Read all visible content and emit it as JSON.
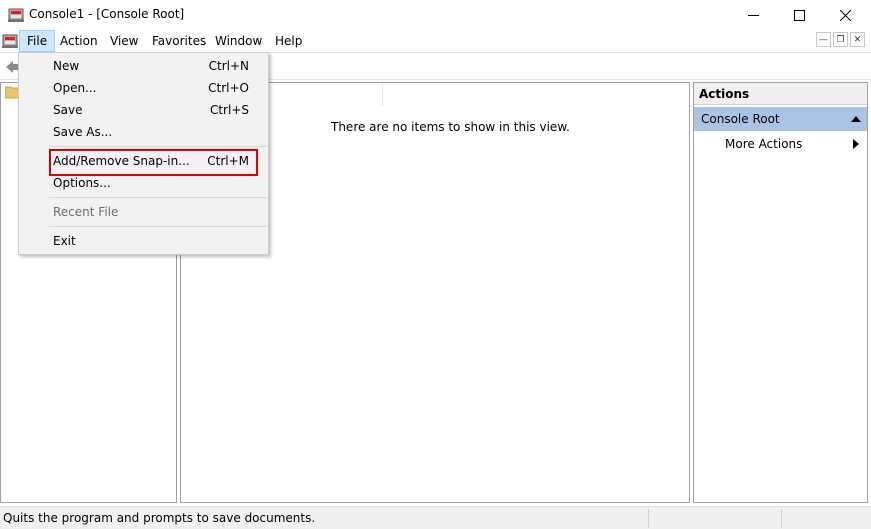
{
  "window": {
    "title": "Console1 - [Console Root]",
    "controls": [
      "minimize",
      "maximize",
      "close"
    ]
  },
  "menubar": {
    "items": [
      {
        "label": "File",
        "state": "open"
      },
      {
        "label": "Action"
      },
      {
        "label": "View"
      },
      {
        "label": "Favorites"
      },
      {
        "label": "Window"
      },
      {
        "label": "Help"
      }
    ]
  },
  "file_menu": {
    "items": [
      {
        "label": "New",
        "shortcut": "Ctrl+N"
      },
      {
        "label": "Open...",
        "shortcut": "Ctrl+O"
      },
      {
        "label": "Save",
        "shortcut": "Ctrl+S"
      },
      {
        "label": "Save As...",
        "shortcut": ""
      },
      {
        "label": "Add/Remove Snap-in...",
        "shortcut": "Ctrl+M",
        "highlighted": true
      },
      {
        "label": "Options...",
        "shortcut": ""
      },
      {
        "label": "Recent File",
        "shortcut": "",
        "disabled": true
      },
      {
        "label": "Exit",
        "shortcut": ""
      }
    ],
    "highlight_color": "#e00000"
  },
  "center_pane": {
    "empty_message": "There are no items to show in this view."
  },
  "actions_pane": {
    "header": "Actions",
    "group_label": "Console Root",
    "items": [
      {
        "label": "More Actions"
      }
    ],
    "group_color": "#a9c4e5"
  },
  "statusbar": {
    "text": "Quits the program and prompts to save documents."
  },
  "icons": {
    "app": "mmc-console-icon",
    "back": "back-arrow-icon",
    "tree_root": "folder-icon"
  }
}
